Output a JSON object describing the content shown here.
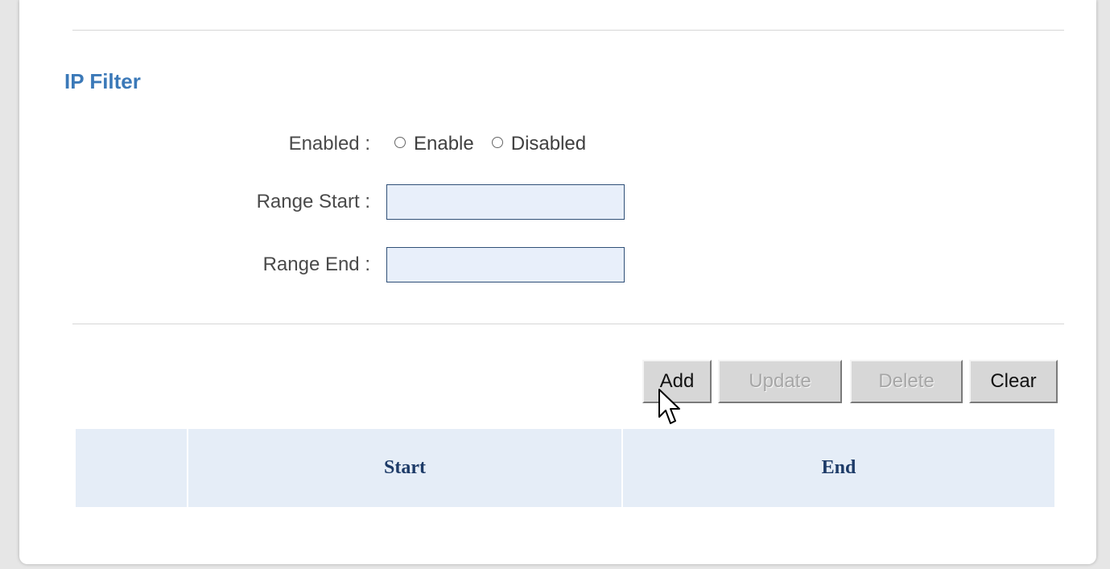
{
  "section": {
    "title": "IP Filter"
  },
  "form": {
    "enabled_label": "Enabled :",
    "enable_option": "Enable",
    "disabled_option": "Disabled",
    "range_start_label": "Range Start :",
    "range_start_value": "",
    "range_end_label": "Range End :",
    "range_end_value": ""
  },
  "buttons": {
    "add": "Add",
    "update": "Update",
    "delete": "Delete",
    "clear": "Clear"
  },
  "table": {
    "columns": [
      "",
      "Start",
      "End"
    ],
    "rows": []
  },
  "colors": {
    "title": "#3b79b8",
    "input_bg": "#e8effa",
    "table_header_bg": "#e5edf7",
    "table_header_text": "#1d3b68"
  },
  "icons": {
    "cursor": "mouse-pointer-icon"
  }
}
